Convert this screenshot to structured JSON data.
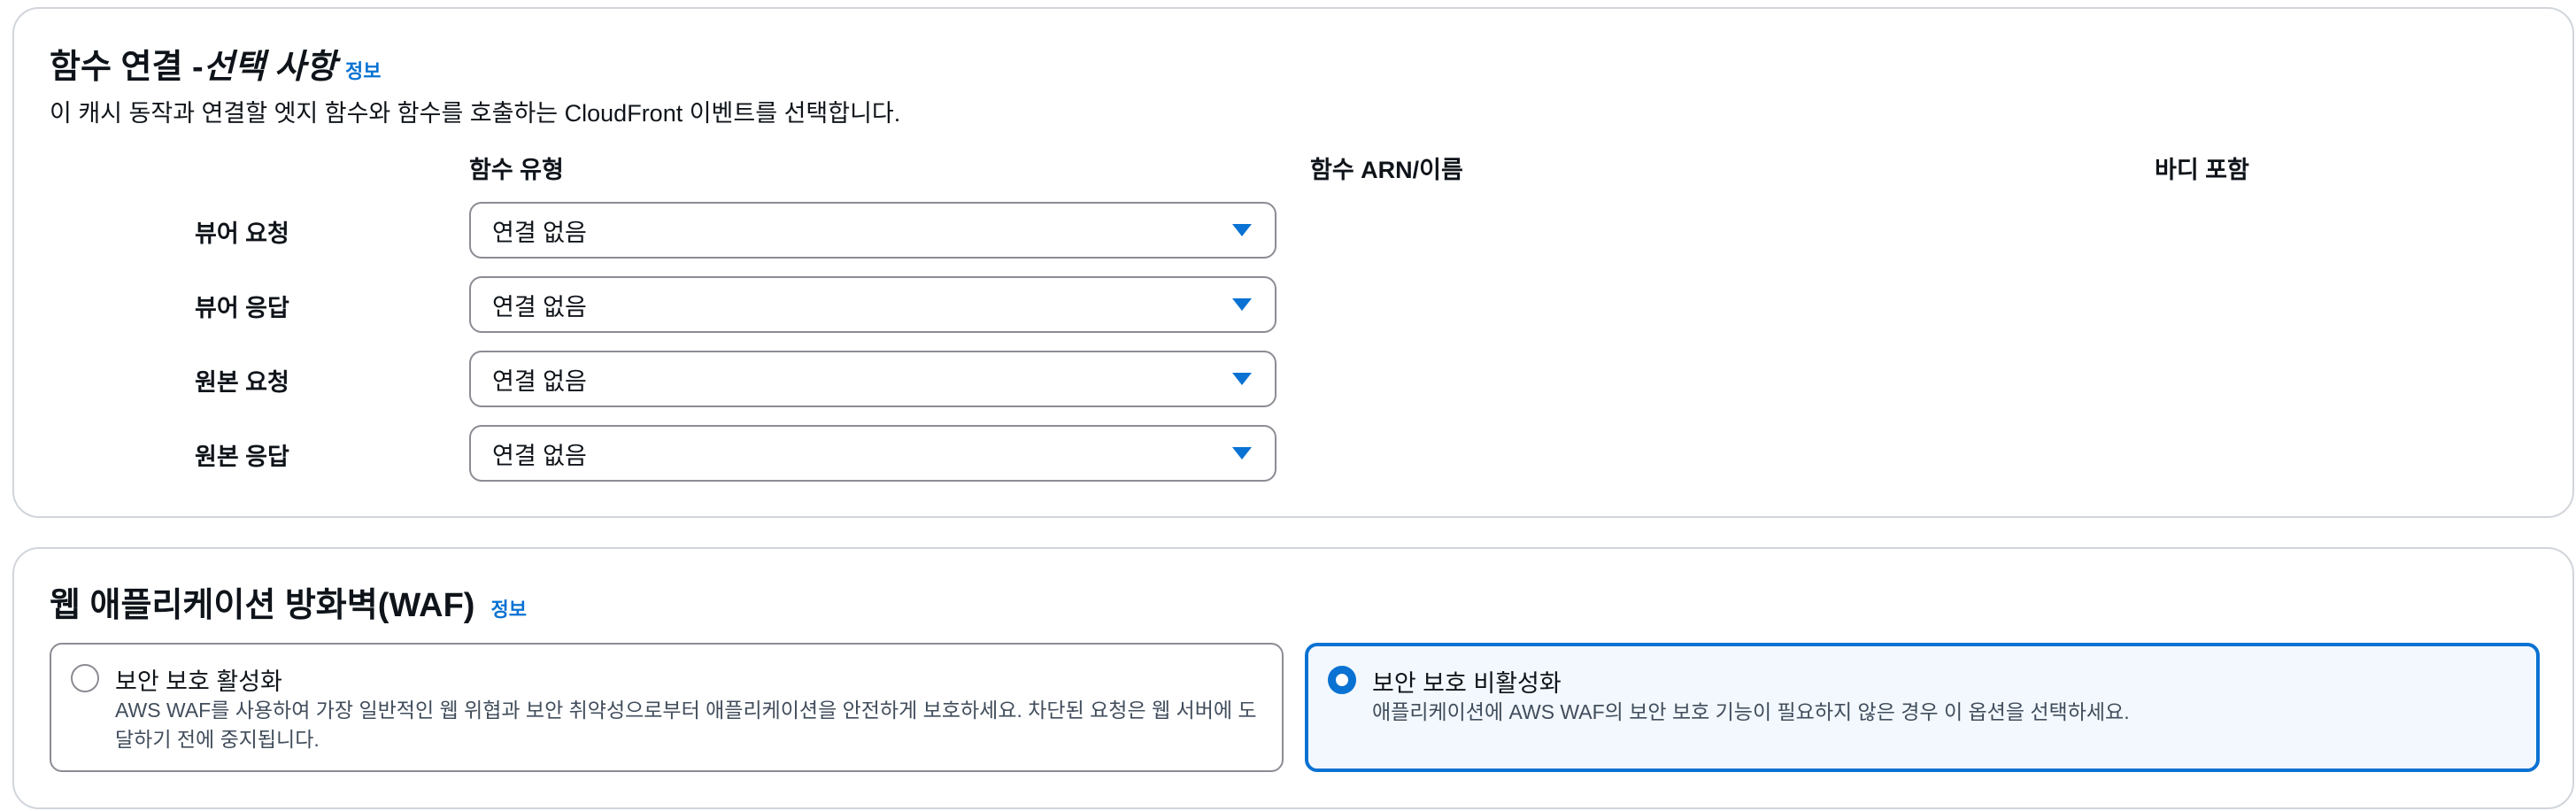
{
  "function_associations": {
    "title_main": "함수 연결 - ",
    "title_optional": "선택 사항",
    "info_label": "정보",
    "description": "이 캐시 동작과 연결할 엣지 함수와 함수를 호출하는 CloudFront 이벤트를 선택합니다.",
    "columns": {
      "function_type": "함수 유형",
      "function_arn": "함수 ARN/이름",
      "include_body": "바디 포함"
    },
    "rows": [
      {
        "label": "뷰어 요청",
        "value": "연결 없음"
      },
      {
        "label": "뷰어 응답",
        "value": "연결 없음"
      },
      {
        "label": "원본 요청",
        "value": "연결 없음"
      },
      {
        "label": "원본 응답",
        "value": "연결 없음"
      }
    ]
  },
  "waf": {
    "title": "웹 애플리케이션 방화벽(WAF)",
    "info_label": "정보",
    "options": [
      {
        "title": "보안 보호 활성화",
        "description": "AWS WAF를 사용하여 가장 일반적인 웹 위협과 보안 취약성으로부터 애플리케이션을 안전하게 보호하세요. 차단된 요청은 웹 서버에 도달하기 전에 중지됩니다.",
        "selected": false
      },
      {
        "title": "보안 보호 비활성화",
        "description": "애플리케이션에 AWS WAF의 보안 보호 기능이 필요하지 않은 경우 이 옵션을 선택하세요.",
        "selected": true
      }
    ]
  },
  "colors": {
    "accent": "#0972d3",
    "text": "#0f141a",
    "border": "#8c8c94",
    "selected_bg": "#f2f8fd"
  },
  "icons": {
    "select_caret": "caret-down-icon"
  }
}
